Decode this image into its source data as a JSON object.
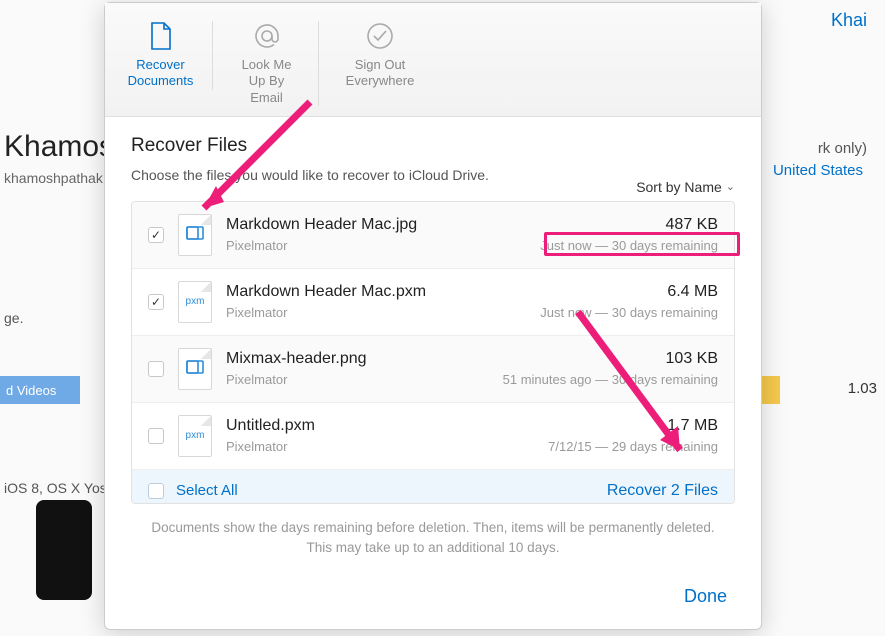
{
  "background": {
    "top_right": "Khai",
    "name": "Khamos",
    "email": "khamoshpathak",
    "rk_only": "rk only)",
    "country": "United States",
    "ge": "ge.",
    "videos_label": "d Videos",
    "number": "1.03",
    "ios_line": "iOS 8, OS X Yos"
  },
  "tabs": {
    "recover": "Recover Documents",
    "lookup": "Look Me Up By Email",
    "signout": "Sign Out Everywhere"
  },
  "content": {
    "title": "Recover Files",
    "subtitle": "Choose the files you would like to recover to iCloud Drive.",
    "sort_label": "Sort by Name"
  },
  "files": [
    {
      "checked": true,
      "thumb": "img",
      "name": "Markdown Header Mac.jpg",
      "app": "Pixelmator",
      "size": "487 KB",
      "when": "Just now — 30 days remaining"
    },
    {
      "checked": true,
      "thumb": "pxm",
      "name": "Markdown Header Mac.pxm",
      "app": "Pixelmator",
      "size": "6.4 MB",
      "when": "Just now — 30 days remaining"
    },
    {
      "checked": false,
      "thumb": "img",
      "name": "Mixmax-header.png",
      "app": "Pixelmator",
      "size": "103 KB",
      "when": "51 minutes ago — 30 days remaining"
    },
    {
      "checked": false,
      "thumb": "pxm",
      "name": "Untitled.pxm",
      "app": "Pixelmator",
      "size": "1.7 MB",
      "when": "7/12/15 — 29 days remaining"
    }
  ],
  "actions": {
    "select_all": "Select All",
    "recover": "Recover 2 Files"
  },
  "footnote": {
    "line1": "Documents show the days remaining before deletion. Then, items will be permanently deleted.",
    "line2": "This may take up to an additional 10 days."
  },
  "done": "Done"
}
